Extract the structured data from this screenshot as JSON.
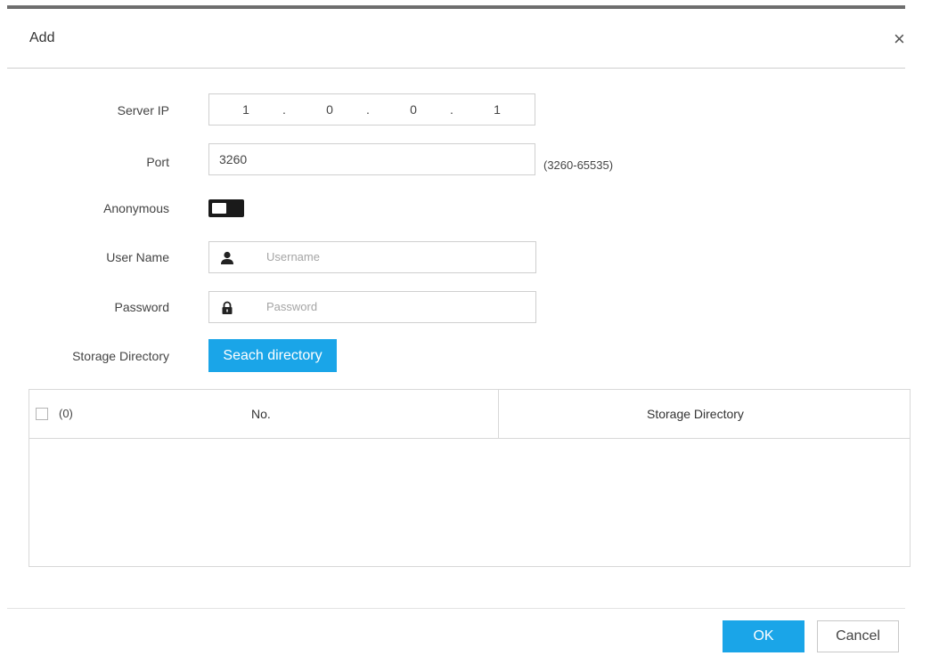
{
  "dialog": {
    "title": "Add",
    "close_glyph": "×"
  },
  "form": {
    "server_ip": {
      "label": "Server IP",
      "octets": [
        "1",
        "0",
        "0",
        "1"
      ],
      "separator": "."
    },
    "port": {
      "label": "Port",
      "value": "3260",
      "range_hint": "(3260-65535)"
    },
    "anonymous": {
      "label": "Anonymous",
      "state": "off"
    },
    "user_name": {
      "label": "User Name",
      "placeholder": "Username",
      "icon": "user-icon"
    },
    "password": {
      "label": "Password",
      "placeholder": "Password",
      "icon": "lock-icon"
    },
    "storage_directory": {
      "label": "Storage Directory",
      "button_label": "Seach directory"
    }
  },
  "table": {
    "selected_count": "(0)",
    "columns": [
      "No.",
      "Storage Directory"
    ],
    "rows": []
  },
  "footer": {
    "ok_label": "OK",
    "cancel_label": "Cancel"
  },
  "colors": {
    "accent": "#1aa5e8",
    "toggle": "#1a1a1a",
    "border": "#cfcfcf"
  }
}
